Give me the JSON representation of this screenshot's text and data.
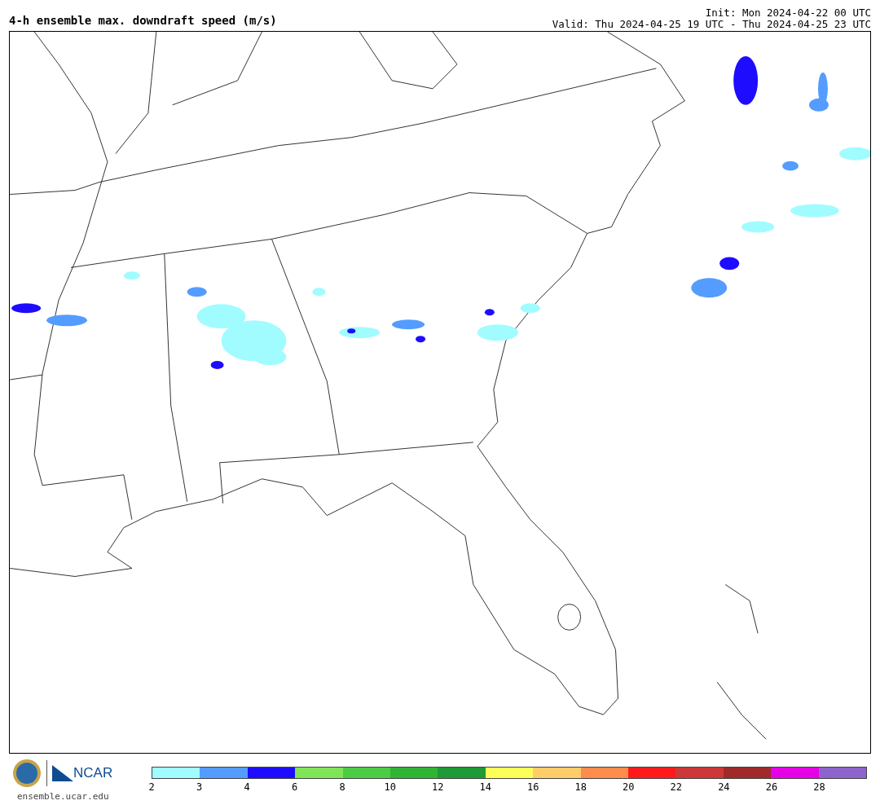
{
  "title": "4-h ensemble max. downdraft speed (m/s)",
  "init": "Init: Mon 2024-04-22 00 UTC",
  "valid": "Valid: Thu 2024-04-25 19 UTC - Thu 2024-04-25 23 UTC",
  "logo": {
    "text": "NCAR",
    "url": "ensemble.ucar.edu"
  },
  "colorbar": {
    "segments": [
      {
        "color": "#a0fcff"
      },
      {
        "color": "#549cff"
      },
      {
        "color": "#1e0cff"
      },
      {
        "color": "#80e458"
      },
      {
        "color": "#4ccc44"
      },
      {
        "color": "#30b434"
      },
      {
        "color": "#1e9a36"
      },
      {
        "color": "#fefe58"
      },
      {
        "color": "#fecc68"
      },
      {
        "color": "#fe8c4c"
      },
      {
        "color": "#fe1a1a"
      },
      {
        "color": "#cc3838"
      },
      {
        "color": "#a02a2a"
      },
      {
        "color": "#e600e6"
      },
      {
        "color": "#8c64cc"
      }
    ],
    "labels": [
      "2",
      "3",
      "4",
      "6",
      "8",
      "10",
      "12",
      "14",
      "16",
      "18",
      "20",
      "22",
      "24",
      "26",
      "28"
    ]
  }
}
